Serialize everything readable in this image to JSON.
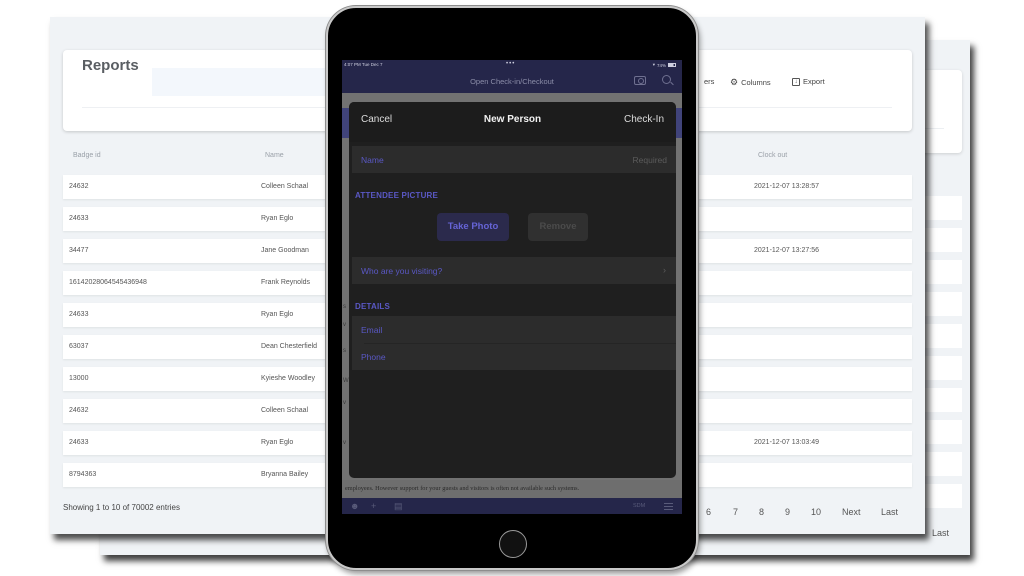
{
  "app": {
    "page_title": "Reports",
    "toolbar": [
      {
        "label": "ers",
        "icon": "filter-icon"
      },
      {
        "label": "Columns",
        "icon": "gear-icon"
      },
      {
        "label": "Export",
        "icon": "export-icon"
      }
    ]
  },
  "table": {
    "columns": [
      "Badge id",
      "Name",
      "Clock out"
    ],
    "rows": [
      {
        "badge": "24632",
        "name": "Colleen Schaal",
        "clock_out": "2021-12-07 13:28:57"
      },
      {
        "badge": "24633",
        "name": "Ryan Eglo",
        "clock_out": ""
      },
      {
        "badge": "34477",
        "name": "Jane Goodman",
        "clock_out": "2021-12-07 13:27:56"
      },
      {
        "badge": "16142028064545436948",
        "name": "Frank Reynolds",
        "clock_out": ""
      },
      {
        "badge": "24633",
        "name": "Ryan Eglo",
        "clock_out": ""
      },
      {
        "badge": "63037",
        "name": "Dean Chesterfield",
        "clock_out": ""
      },
      {
        "badge": "13000",
        "name": "Kyieshe Woodley",
        "clock_out": ""
      },
      {
        "badge": "24632",
        "name": "Colleen Schaal",
        "clock_out": ""
      },
      {
        "badge": "24633",
        "name": "Ryan Eglo",
        "clock_out": "2021-12-07 13:03:49"
      },
      {
        "badge": "8794363",
        "name": "Bryanna Bailey",
        "clock_out": ""
      }
    ],
    "footer": "Showing 1 to 10 of 70002 entries",
    "pagination": [
      "6",
      "7",
      "8",
      "9",
      "10",
      "Next",
      "Last"
    ],
    "back_window_last": "Last"
  },
  "ipad": {
    "status": {
      "time": "4:07 PM  Tue Dec 7",
      "dots": "•••",
      "battery": "74%"
    },
    "nav_title": "Open Check-in/Checkout",
    "modal": {
      "cancel": "Cancel",
      "title": "New Person",
      "confirm": "Check-In",
      "name_label": "Name",
      "name_placeholder": "Required",
      "picture_section": "ATTENDEE PICTURE",
      "take_photo": "Take Photo",
      "remove": "Remove",
      "visiting_label": "Who are you visiting?",
      "details_section": "DETAILS",
      "email_label": "Email",
      "phone_label": "Phone"
    },
    "background_text": "employees. However support for your guests and visitors is often not available such systems.",
    "tabbar": {
      "label": "SDM"
    }
  }
}
